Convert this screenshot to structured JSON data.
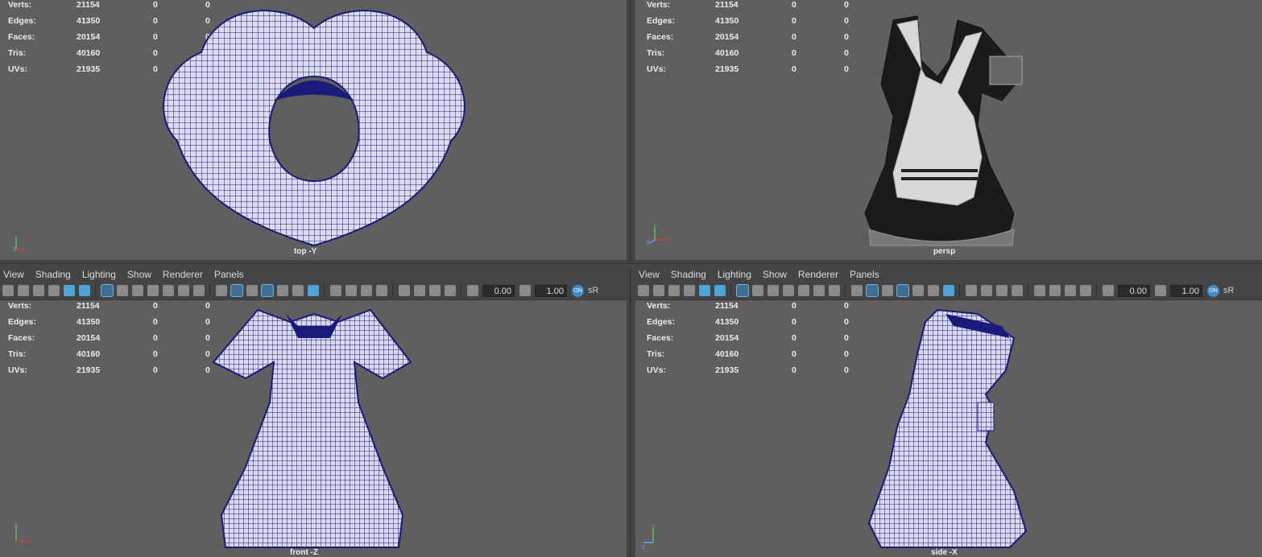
{
  "stats_labels": [
    "Verts:",
    "Edges:",
    "Faces:",
    "Tris:",
    "UVs:"
  ],
  "stats_values": [
    "21154",
    "41350",
    "20154",
    "40160",
    "21935"
  ],
  "stats_zero": "0",
  "menu": [
    "View",
    "Shading",
    "Lighting",
    "Show",
    "Renderer",
    "Panels"
  ],
  "toolbar": {
    "exposure": "0.00",
    "gamma": "1.00",
    "color_mgmt": "ON",
    "srgb": "sR"
  },
  "viewports": {
    "top": {
      "camera": "top -Y"
    },
    "persp": {
      "camera": "persp"
    },
    "front": {
      "camera": "front -Z"
    },
    "side": {
      "camera": "side -X"
    }
  },
  "colors": {
    "viewport_bg": "#5f5f5f",
    "wire": "#1a1a7a",
    "panel": "#444444",
    "accent": "#4ea4d6"
  },
  "axis_labels": {
    "y": "y",
    "x": "x",
    "z": "z"
  }
}
